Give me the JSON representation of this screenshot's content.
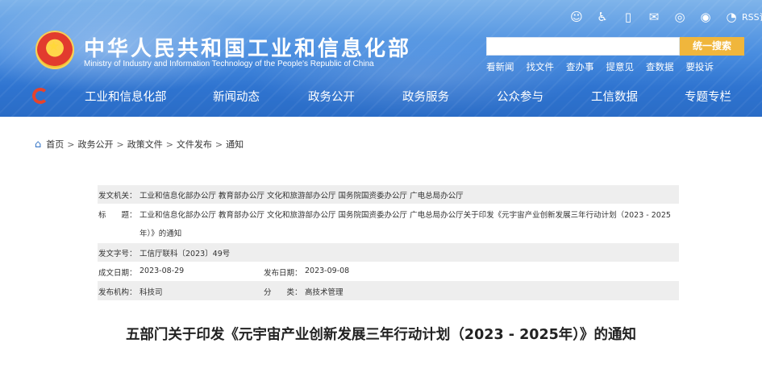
{
  "header": {
    "title": "中华人民共和国工业和信息化部",
    "subtitle": "Ministry of Industry and Information Technology of the People's Republic of China",
    "utility_icons": [
      "accessibility-robot-icon",
      "wheelchair-icon",
      "mobile-icon",
      "mail-icon",
      "weibo-icon",
      "wechat-icon",
      "rss-icon"
    ],
    "rss_label": "RSS订阅",
    "search": {
      "value": "",
      "button_label": "统一搜索"
    },
    "quick_links": [
      "看新闻",
      "找文件",
      "查办事",
      "提意见",
      "查数据",
      "要投诉"
    ]
  },
  "nav": {
    "items": [
      "工业和信息化部",
      "新闻动态",
      "政务公开",
      "政务服务",
      "公众参与",
      "工信数据",
      "专题专栏"
    ]
  },
  "breadcrumb": {
    "items": [
      "首页",
      "政务公开",
      "政策文件",
      "文件发布",
      "通知"
    ],
    "separator": ">"
  },
  "meta": {
    "issuer_label": "发文机关：",
    "issuer_value": "工业和信息化部办公厅 教育部办公厅 文化和旅游部办公厅 国务院国资委办公厅 广电总局办公厅",
    "title_label": "标　　题：",
    "title_value_line1": "工业和信息化部办公厅 教育部办公厅 文化和旅游部办公厅 国务院国资委办公厅 广电总局办公厅关于印发《元宇宙产业创新发展三年行动计划（2023 - 2025",
    "title_value_line2": "年）》的通知",
    "docno_label": "发文字号：",
    "docno_value": "工信厅联科〔2023〕49号",
    "written_label": "成文日期：",
    "written_value": "2023-08-29",
    "published_label": "发布日期：",
    "published_value": "2023-09-08",
    "org_label": "发布机构：",
    "org_value": "科技司",
    "category_label": "分　　类：",
    "category_value": "高技术管理"
  },
  "document": {
    "title": "五部门关于印发《元宇宙产业创新发展三年行动计划（2023 - 2025年）》的通知"
  },
  "colors": {
    "header_blue": "#2f74d0",
    "search_button": "#f0b63c",
    "meta_shade": "#eeeeee"
  }
}
